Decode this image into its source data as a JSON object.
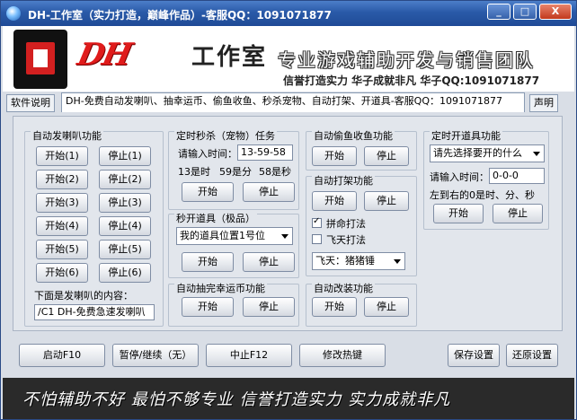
{
  "window": {
    "title": "DH-工作室（实力打造，巅峰作品）-客服QQ：1091071877",
    "minimize": "_",
    "maximize": "□",
    "close": "X"
  },
  "header": {
    "logo_dh": "DH",
    "studio": "工作室",
    "slogan": "专业游戏辅助开发与销售团队",
    "sub": "信誉打造实力 华子成就非凡   华子QQ:1091071877"
  },
  "tabs": [
    {
      "label": "软件说明"
    },
    {
      "label": "DH-免费自动发喇叭、抽幸运币、偷鱼收鱼、秒杀宠物、自动打架、开道具-客服QQ：1091071877"
    },
    {
      "label": "声明"
    }
  ],
  "speaker": {
    "title": "自动发喇叭功能",
    "rows": [
      {
        "start": "开始(1)",
        "stop": "停止(1)"
      },
      {
        "start": "开始(2)",
        "stop": "停止(2)"
      },
      {
        "start": "开始(3)",
        "stop": "停止(3)"
      },
      {
        "start": "开始(4)",
        "stop": "停止(4)"
      },
      {
        "start": "开始(5)",
        "stop": "停止(5)"
      },
      {
        "start": "开始(6)",
        "stop": "停止(6)"
      }
    ],
    "content_label": "下面是发喇叭的内容：",
    "content_value": "/C1 DH-免费急速发喇叭"
  },
  "timed_kill": {
    "title": "定时秒杀（宠物）任务",
    "time_label": "请输入时间：",
    "time_value": "13-59-58",
    "hint_h": "13是时",
    "hint_m": "59是分",
    "hint_s": "58是秒",
    "start": "开始",
    "stop": "停止"
  },
  "instant_item": {
    "title": "秒开道具（极品）",
    "select_value": "我的道具位置1号位",
    "start": "开始",
    "stop": "停止"
  },
  "lucky_coin": {
    "title": "自动抽完幸运币功能",
    "start": "开始",
    "stop": "停止"
  },
  "fish": {
    "title": "自动偷鱼收鱼功能",
    "start": "开始",
    "stop": "停止"
  },
  "fight": {
    "title": "自动打架功能",
    "start": "开始",
    "stop": "停止",
    "opt1": "拼命打法",
    "opt1_checked": true,
    "opt2": "飞天打法",
    "opt2_checked": false,
    "select_value": "飞天：猪猪锤"
  },
  "outfit": {
    "title": "自动改装功能",
    "start": "开始",
    "stop": "停止"
  },
  "timed_open": {
    "title": "定时开道具功能",
    "select_value": "请先选择要开的什么",
    "time_label": "请输入时间：",
    "time_value": "0-0-0",
    "hint": "左到右的0是时、分、秒",
    "start": "开始",
    "stop": "停止"
  },
  "bottom": {
    "launch": "启动F10",
    "pause": "暂停/继续（无）",
    "abort": "中止F12",
    "hotkey": "修改热键",
    "save": "保存设置",
    "restore": "还原设置"
  },
  "footer": {
    "text": "不怕辅助不好 最怕不够专业 信誉打造实力 实力成就非凡"
  }
}
